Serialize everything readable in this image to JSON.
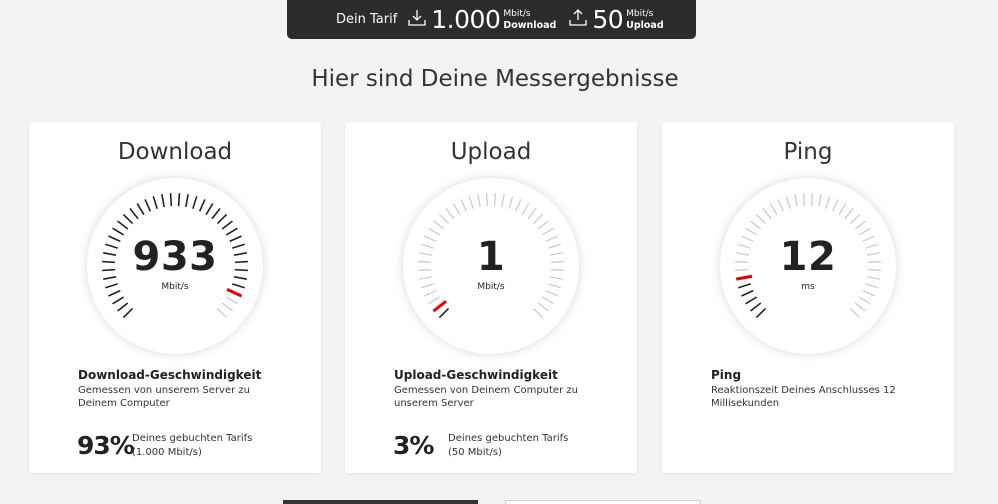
{
  "tarif": {
    "label": "Dein Tarif",
    "download_value": "1.000",
    "download_unit": "Mbit/s",
    "download_caption": "Download",
    "upload_value": "50",
    "upload_unit": "Mbit/s",
    "upload_caption": "Upload"
  },
  "page_title": "Hier sind Deine Messergebnisse",
  "cards": [
    {
      "title": "Download",
      "value": "933",
      "unit": "Mbit/s",
      "gauge_fraction": 0.93,
      "heading": "Download-Geschwindigkeit",
      "description": "Gemessen von unserem Server zu Deinem Computer",
      "percent": "93%",
      "percent_desc_line1": "Deines gebuchten Tarifs",
      "percent_desc_line2": "(1.000 Mbit/s)"
    },
    {
      "title": "Upload",
      "value": "1",
      "unit": "Mbit/s",
      "gauge_fraction": 0.03,
      "heading": "Upload-Geschwindigkeit",
      "description": "Gemessen von Deinem Computer zu unserem Server",
      "percent": "3%",
      "percent_desc_line1": "Deines gebuchten Tarifs",
      "percent_desc_line2": "(50 Mbit/s)"
    },
    {
      "title": "Ping",
      "value": "12",
      "unit": "ms",
      "gauge_fraction": 0.12,
      "heading": "Ping",
      "description": "Reaktionszeit Deines Anschlusses 12 Millisekunden",
      "percent": "",
      "percent_desc_line1": "",
      "percent_desc_line2": ""
    }
  ],
  "colors": {
    "accent": "#e60000",
    "tick_active": "#222222",
    "tick_inactive": "#c8c8c8",
    "bar_bg": "#2c2c2c"
  }
}
